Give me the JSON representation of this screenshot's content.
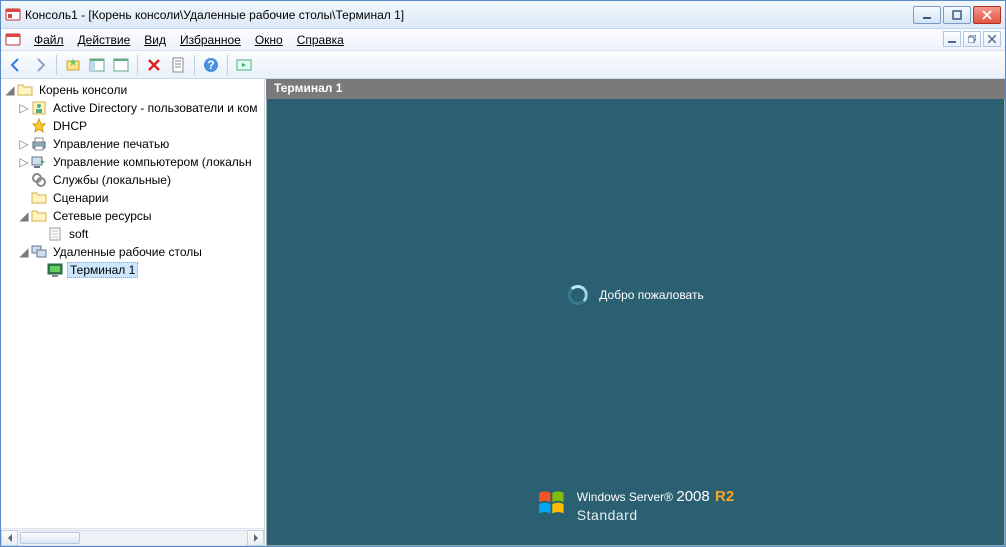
{
  "title": "Консоль1 - [Корень консоли\\Удаленные рабочие столы\\Терминал 1]",
  "menu": {
    "file": "Файл",
    "action": "Действие",
    "view": "Вид",
    "favorites": "Избранное",
    "window": "Окно",
    "help": "Справка"
  },
  "tree": {
    "root": "Корень консоли",
    "ad": "Active Directory - пользователи и ком",
    "dhcp": "DHCP",
    "print": "Управление печатью",
    "compmgmt": "Управление компьютером (локальн",
    "services": "Службы (локальные)",
    "scripts": "Сценарии",
    "netres": "Сетевые ресурсы",
    "soft": "soft",
    "rdp": "Удаленные рабочие столы",
    "terminal1": "Терминал 1"
  },
  "right": {
    "header": "Терминал 1",
    "welcome": "Добро пожаловать",
    "product_brand": "Windows Server",
    "product_year": "2008",
    "product_r2": "R2",
    "product_edition": "Standard"
  }
}
